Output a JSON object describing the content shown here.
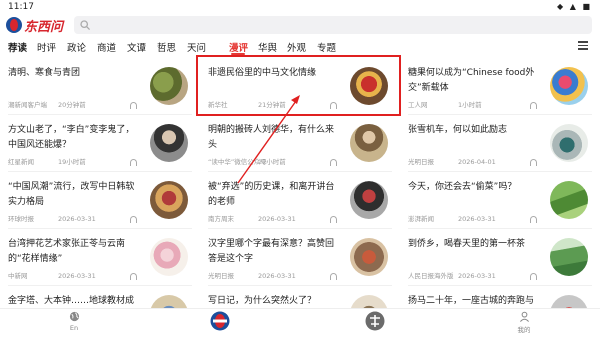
{
  "status_bar": {
    "time": "11:17",
    "icons": "◆ ▲ ■"
  },
  "app": {
    "logo_text": "东西问",
    "search_placeholder": ""
  },
  "channels": [
    {
      "label": "荐读",
      "style": "bold"
    },
    {
      "label": "时评",
      "style": "normal"
    },
    {
      "label": "政论",
      "style": "normal"
    },
    {
      "label": "商道",
      "style": "normal"
    },
    {
      "label": "文谭",
      "style": "normal"
    },
    {
      "label": "哲思",
      "style": "normal"
    },
    {
      "label": "天问",
      "style": "normal"
    },
    {
      "label": "漫评",
      "style": "active"
    },
    {
      "label": "华舆",
      "style": "normal"
    },
    {
      "label": "外观",
      "style": "normal"
    },
    {
      "label": "专题",
      "style": "normal"
    }
  ],
  "articles": [
    {
      "title": "清明、寒食与青团",
      "source": "潮新闻客户端",
      "date": "20分钟前",
      "thumb": "food"
    },
    {
      "title": "非遗民俗里的中马文化情缘",
      "source": "新华社",
      "date": "21分钟前",
      "thumb": "lion"
    },
    {
      "title": "糖果何以成为“Chinese food外交”新载体",
      "source": "工人网",
      "date": "1小时前",
      "thumb": "candy"
    },
    {
      "title": "方文山老了，“李白”变李鬼了，中国风还能爆？",
      "source": "红星新闻",
      "date": "19小时前",
      "thumb": "singer"
    },
    {
      "title": "明朝的搬砖人刘德华，有什么来头",
      "source": "“读中华”微信公众号",
      "date": "22小时前",
      "thumb": "actor"
    },
    {
      "title": "张雪机车，何以如此励志",
      "source": "光明日报",
      "date": "2026-04-01",
      "thumb": "moto"
    },
    {
      "title": "“中国风潮”流行，改写中日韩软实力格局",
      "source": "环球时报",
      "date": "2026-03-31",
      "thumb": "crowd"
    },
    {
      "title": "被“弃选”的历史课，和离开讲台的老师",
      "source": "南方周末",
      "date": "2026-03-31",
      "thumb": "teacher"
    },
    {
      "title": "今天，你还会去“偷菜”吗？",
      "source": "澎湃新闻",
      "date": "2026-03-31",
      "thumb": "farm"
    },
    {
      "title": "台湾押花艺术家张正苓与云南的“花样情缘”",
      "source": "中新网",
      "date": "2026-03-31",
      "thumb": "flower"
    },
    {
      "title": "汉字里哪个字最有深意？高赞回答是这个字",
      "source": "光明日报",
      "date": "2026-03-31",
      "thumb": "char"
    },
    {
      "title": "到侨乡，喝春天里的第一杯茶",
      "source": "人民日报海外版",
      "date": "2026-03-31",
      "thumb": "tea"
    },
    {
      "title": "金字塔、大本钟……地球教材成",
      "source": "",
      "date": "",
      "thumb": "world"
    },
    {
      "title": "写日记，为什么突然火了？",
      "source": "",
      "date": "",
      "thumb": "diary"
    },
    {
      "title": "扬马二十年，一座古城的奔跑与",
      "source": "",
      "date": "",
      "thumb": "run"
    }
  ],
  "tabs": [
    {
      "label": "En",
      "icon": "globe-icon"
    },
    {
      "label": "",
      "icon": "home-logo-icon"
    },
    {
      "label": "",
      "icon": "ai-assistant-icon"
    },
    {
      "label": "我的",
      "icon": "profile-icon"
    }
  ],
  "colors": {
    "accent": "#e53935",
    "brand_red": "#d7262e",
    "brand_blue": "#1c4f9c",
    "annotation": "#e02020"
  }
}
